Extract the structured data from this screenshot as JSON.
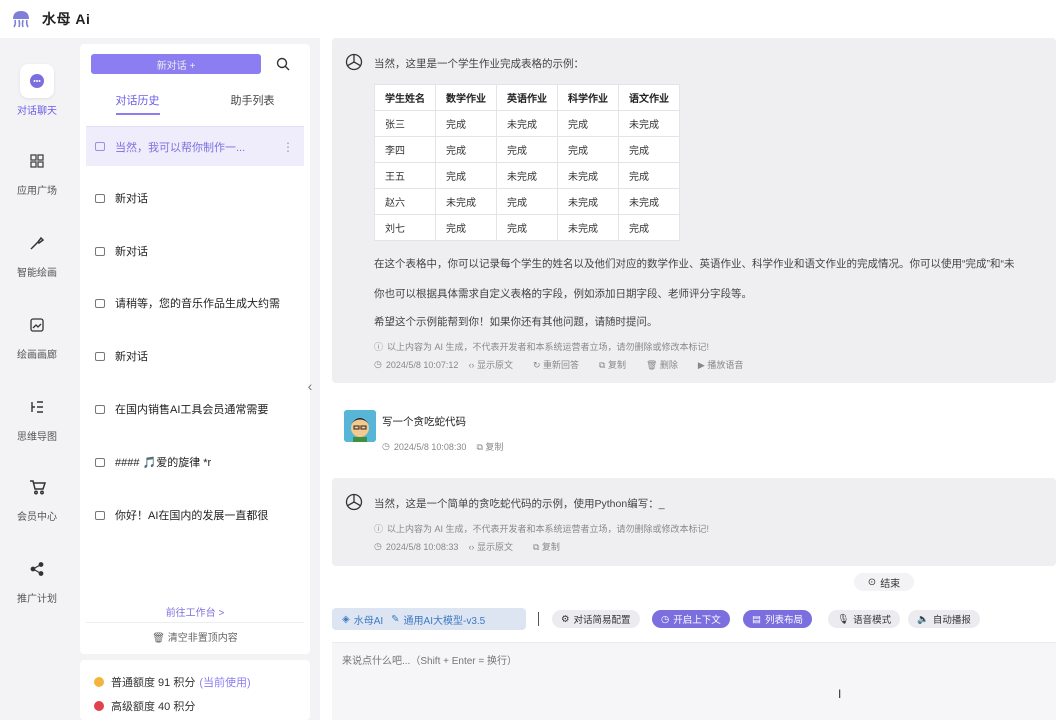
{
  "app": {
    "title": "水母 Ai",
    "brand_color": "#6c5ce7"
  },
  "nav": {
    "items": [
      {
        "label": "对话聊天",
        "icon": "chat-bubble-icon"
      },
      {
        "label": "应用广场",
        "icon": "grid-icon"
      },
      {
        "label": "智能绘画",
        "icon": "paintbrush-icon"
      },
      {
        "label": "绘画画廊",
        "icon": "gallery-icon"
      },
      {
        "label": "思维导图",
        "icon": "mindmap-icon"
      },
      {
        "label": "会员中心",
        "icon": "cart-icon"
      },
      {
        "label": "推广计划",
        "icon": "share-icon"
      }
    ]
  },
  "sidebar": {
    "new_button": "新对话 +",
    "tabs": [
      "对话历史",
      "助手列表"
    ],
    "history": [
      "当然，我可以帮你制作一...",
      "新对话",
      "新对话",
      "请稍等，您的音乐作品生成大约需",
      "新对话",
      "在国内销售AI工具会员通常需要",
      "#### 🎵爱的旋律 *r",
      "你好！AI在国内的发展一直都很"
    ],
    "goto_workbench": "前往工作台 >",
    "clear_label": "清空非置顶内容"
  },
  "credits": {
    "normal": "普通额度 91 积分",
    "normal_note": "(当前使用)",
    "premium": "高级额度 40 积分"
  },
  "chat": {
    "msg1_intro": "当然，这里是一个学生作业完成表格的示例：",
    "table_headers": [
      "学生姓名",
      "数学作业",
      "英语作业",
      "科学作业",
      "语文作业"
    ],
    "table_rows": [
      [
        "张三",
        "完成",
        "未完成",
        "完成",
        "未完成"
      ],
      [
        "李四",
        "完成",
        "完成",
        "完成",
        "完成"
      ],
      [
        "王五",
        "完成",
        "未完成",
        "未完成",
        "完成"
      ],
      [
        "赵六",
        "未完成",
        "完成",
        "未完成",
        "未完成"
      ],
      [
        "刘七",
        "完成",
        "完成",
        "未完成",
        "完成"
      ]
    ],
    "msg1_p1": "在这个表格中，你可以记录每个学生的姓名以及他们对应的数学作业、英语作业、科学作业和语文作业的完成情况。你可以使用“完成”和“未",
    "msg1_p2": "你也可以根据具体需求自定义表格的字段，例如添加日期字段、老师评分字段等。",
    "msg1_p3": "希望这个示例能帮到你！如果你还有其他问题，请随时提问。",
    "disclaimer": "以上内容为 AI 生成，不代表开发者和本系统运营者立场，请勿删除或修改本标记!",
    "msg1_time": "2024/5/8 10:07:12",
    "act_show_source": "显示原文",
    "act_regenerate": "重新回答",
    "act_copy": "复制",
    "act_delete": "删除",
    "act_play": "播放语音",
    "user_text": "写一个贪吃蛇代码",
    "user_time": "2024/5/8 10:08:30",
    "msg2_text": "当然，这是一个简单的贪吃蛇代码的示例，使用Python编写：_",
    "msg2_time": "2024/5/8 10:08:33",
    "end_label": "结束"
  },
  "toolbar": {
    "model_brand": "水母AI",
    "model_name": "通用AI大模型-v3.5",
    "buttons": [
      "对话简易配置",
      "开启上下文",
      "列表布局",
      "语音模式",
      "自动播报"
    ]
  },
  "input": {
    "placeholder": "来说点什么吧...（Shift + Enter = 换行）"
  }
}
